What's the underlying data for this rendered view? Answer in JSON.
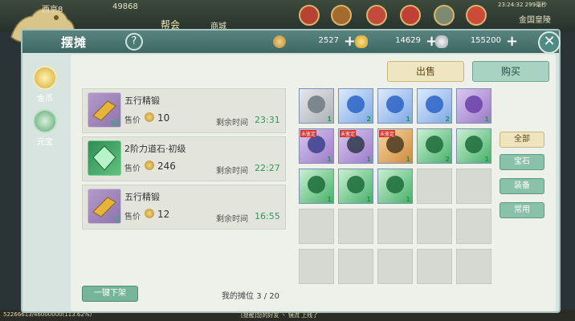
{
  "hud": {
    "player_name": "西京8",
    "power": "49868",
    "guild_label": "帮会",
    "other_label": "商城",
    "clock": "23:24:32 299毫秒",
    "location": "金国皇陵",
    "footer_exp": "52266613/46000000(113.62%)",
    "footer_chat": "[提醒]您的好友 丶 镜流 上线了"
  },
  "window": {
    "title": "摆摊",
    "help_label": "?",
    "close_label": "✕"
  },
  "currencies": [
    {
      "name": "coin-copper",
      "value": "2527",
      "color": "#d9b15b"
    },
    {
      "name": "coin-gold",
      "value": "14629",
      "color": "#e7c04b"
    },
    {
      "name": "coin-silver",
      "value": "155200",
      "color": "#c9ced1"
    }
  ],
  "side_tabs": [
    {
      "label": "金币",
      "active": true
    },
    {
      "label": "元宝",
      "active": false
    }
  ],
  "actions": {
    "sell": "出售",
    "buy": "购买"
  },
  "listings": [
    {
      "name": "五行精锻",
      "price_label": "售价",
      "price": "10",
      "time_label": "剩余时间",
      "time": "23:31",
      "count": "13",
      "icon": "gold-bar-icon"
    },
    {
      "name": "2阶力道石·初级",
      "price_label": "售价",
      "price": "246",
      "time_label": "剩余时间",
      "time": "22:27",
      "count": "",
      "icon": "green-gem-icon"
    },
    {
      "name": "五行精锻",
      "price_label": "售价",
      "price": "12",
      "time_label": "剩余时间",
      "time": "16:55",
      "count": "5",
      "icon": "gold-bar-icon"
    }
  ],
  "footer": {
    "quick_remove": "一键下架",
    "stall_label": "我的摊位",
    "stall_value": "3 / 20"
  },
  "grid_items": [
    {
      "icon": "grey-flame-orb-icon",
      "qty": "1",
      "tag": ""
    },
    {
      "icon": "blue-flame-orb-icon",
      "qty": "2",
      "tag": ""
    },
    {
      "icon": "blue-flame-orb-icon",
      "qty": "1",
      "tag": ""
    },
    {
      "icon": "blue-flame-orb-icon",
      "qty": "2",
      "tag": ""
    },
    {
      "icon": "purple-robe-icon",
      "qty": "1",
      "tag": ""
    },
    {
      "icon": "purple-belt-icon",
      "qty": "1",
      "tag": "未鉴定"
    },
    {
      "icon": "sword-icon",
      "qty": "1",
      "tag": "未鉴定"
    },
    {
      "icon": "bracelet-icon",
      "qty": "1",
      "tag": "未鉴定"
    },
    {
      "icon": "green-gem-icon",
      "qty": "2",
      "tag": ""
    },
    {
      "icon": "green-gem-icon",
      "qty": "1",
      "tag": ""
    },
    {
      "icon": "green-gem-icon",
      "qty": "1",
      "tag": ""
    },
    {
      "icon": "green-gem-icon",
      "qty": "1",
      "tag": ""
    },
    {
      "icon": "green-gem-icon",
      "qty": "1",
      "tag": ""
    }
  ],
  "categories": [
    {
      "label": "全部",
      "active": true
    },
    {
      "label": "宝石",
      "active": false
    },
    {
      "label": "装备",
      "active": false
    },
    {
      "label": "常用",
      "active": false
    }
  ]
}
